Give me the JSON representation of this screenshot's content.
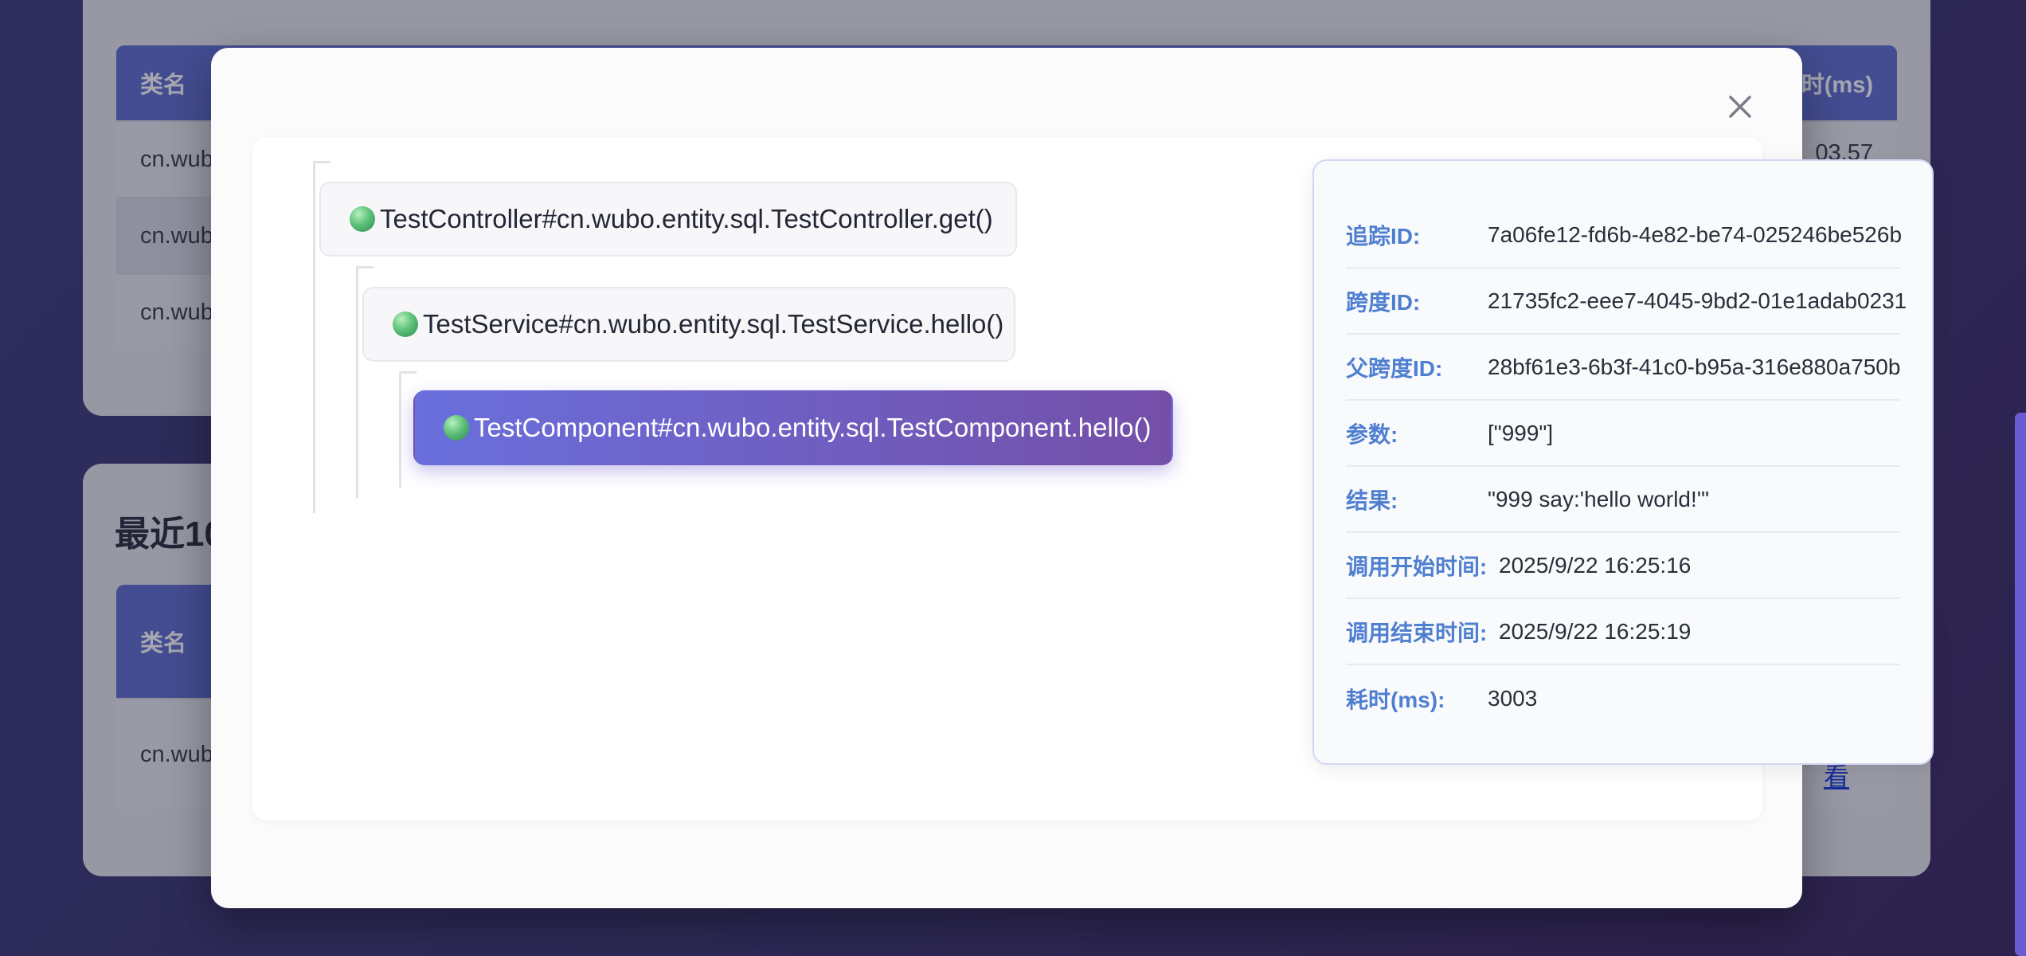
{
  "background": {
    "top_table": {
      "headers": [
        "类名",
        "时(ms)"
      ],
      "rows": [
        {
          "class": "cn.wub",
          "value": "03.57"
        },
        {
          "class": "cn.wub",
          "value": ""
        },
        {
          "class": "cn.wub",
          "value": ""
        }
      ]
    },
    "bottom_section": {
      "heading": "最近10",
      "headers": [
        "类名"
      ],
      "rows": [
        {
          "class": "cn.wub",
          "action": "看"
        }
      ]
    }
  },
  "modal": {
    "close_icon": "close-icon",
    "tree": [
      {
        "label": "TestController#cn.wubo.entity.sql.TestController.get()",
        "active": false
      },
      {
        "label": "TestService#cn.wubo.entity.sql.TestService.hello()",
        "active": false
      },
      {
        "label": "TestComponent#cn.wubo.entity.sql.TestComponent.hello()",
        "active": true
      }
    ],
    "details": [
      {
        "label": "追踪ID:",
        "value": "7a06fe12-fd6b-4e82-be74-025246be526b"
      },
      {
        "label": "跨度ID:",
        "value": "21735fc2-eee7-4045-9bd2-01e1adab0231"
      },
      {
        "label": "父跨度ID:",
        "value": "28bf61e3-6b3f-41c0-b95a-316e880a750b"
      },
      {
        "label": "参数:",
        "value": "[\"999\"]"
      },
      {
        "label": "结果:",
        "value": "\"999 say:'hello world!'\""
      },
      {
        "label": "调用开始时间:",
        "value": "2025/9/22 16:25:16"
      },
      {
        "label": "调用结束时间:",
        "value": "2025/9/22 16:25:19"
      },
      {
        "label": "耗时(ms):",
        "value": "3003"
      }
    ]
  },
  "colors": {
    "accent_start": "#6a6fdc",
    "accent_end": "#744fa8",
    "label_blue": "#4f7fd0",
    "header_blue": "#5f6fcf"
  }
}
